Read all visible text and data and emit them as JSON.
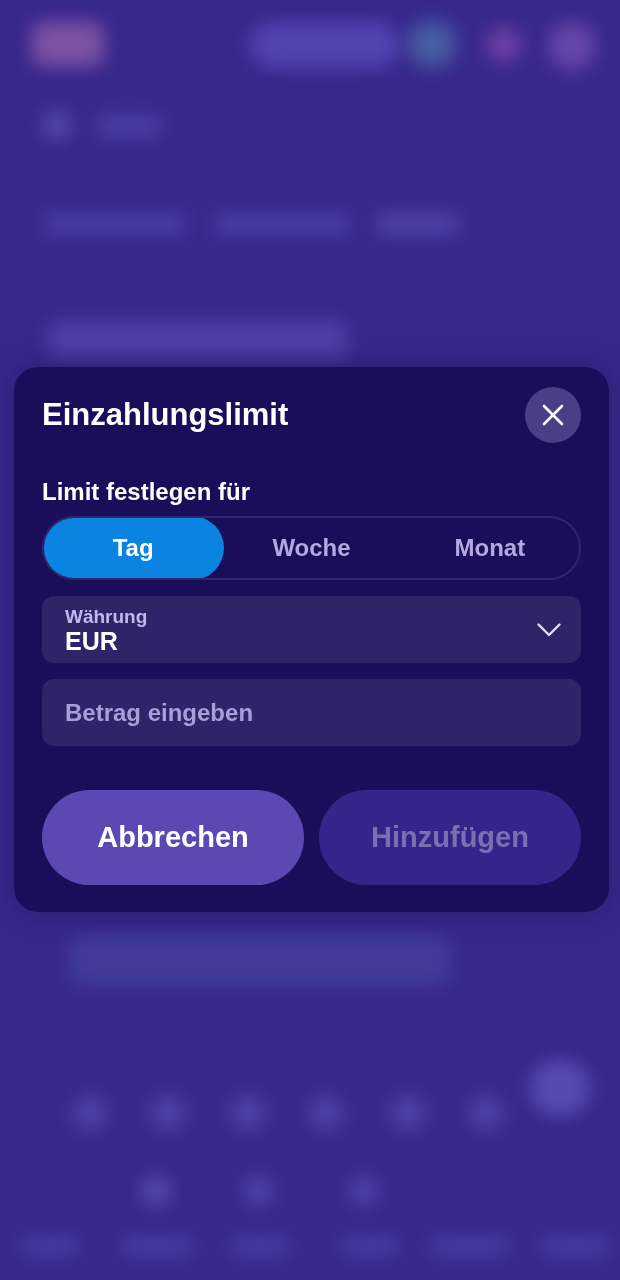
{
  "dialog": {
    "title": "Einzahlungslimit",
    "period_label": "Limit festlegen für",
    "periods": [
      {
        "label": "Tag",
        "selected": true
      },
      {
        "label": "Woche",
        "selected": false
      },
      {
        "label": "Monat",
        "selected": false
      }
    ],
    "currency": {
      "label": "Währung",
      "value": "EUR"
    },
    "amount": {
      "placeholder": "Betrag eingeben"
    },
    "buttons": [
      {
        "label": "Abbrechen",
        "disabled": false
      },
      {
        "label": "Hinzufügen",
        "disabled": true
      }
    ]
  }
}
